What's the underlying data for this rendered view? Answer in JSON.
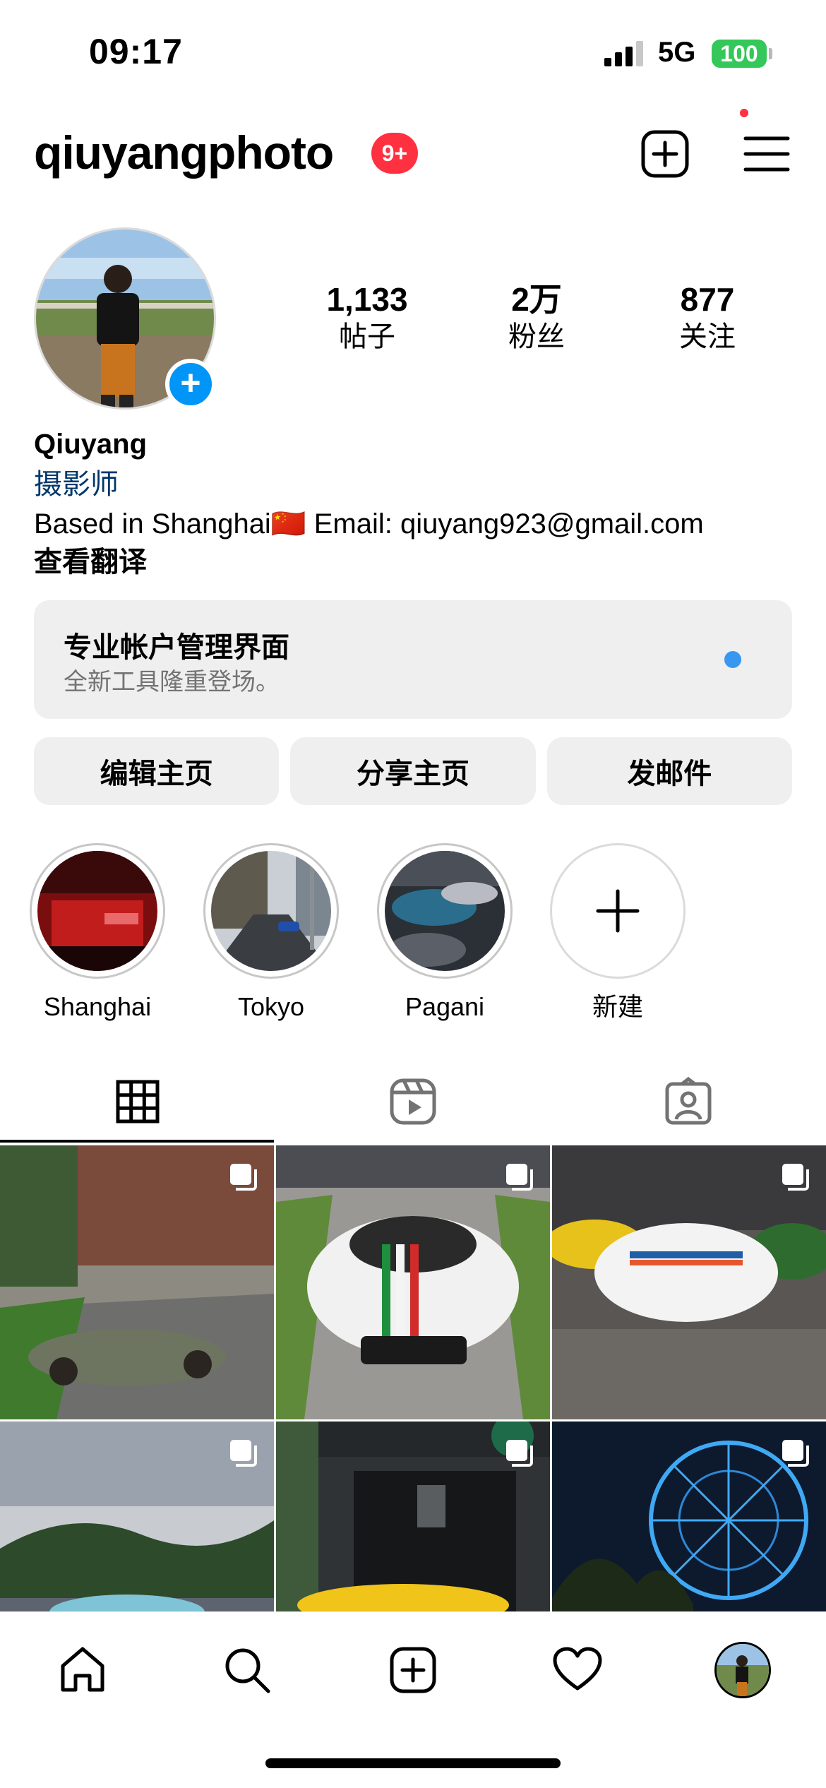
{
  "status_bar": {
    "time": "09:17",
    "network": "5G",
    "battery": "100"
  },
  "header": {
    "username": "qiuyangphoto",
    "notification_badge": "9+"
  },
  "profile": {
    "stats": [
      {
        "value": "1,133",
        "label": "帖子"
      },
      {
        "value": "2万",
        "label": "粉丝"
      },
      {
        "value": "877",
        "label": "关注"
      }
    ],
    "name": "Qiuyang",
    "category": "摄影师",
    "bio": "Based in Shanghai🇨🇳 Email: qiuyang923@gmail.com",
    "translate": "查看翻译"
  },
  "professional_dashboard": {
    "title": "专业帐户管理界面",
    "subtitle": "全新工具隆重登场。"
  },
  "actions": {
    "edit": "编辑主页",
    "share": "分享主页",
    "email": "发邮件"
  },
  "highlights": [
    {
      "label": "Shanghai"
    },
    {
      "label": "Tokyo"
    },
    {
      "label": "Pagani"
    },
    {
      "label": "新建"
    }
  ],
  "tabs": [
    "grid-icon",
    "reels-icon",
    "tagged-icon"
  ],
  "bottom_nav": [
    "home-icon",
    "search-icon",
    "create-icon",
    "heart-icon",
    "profile-avatar"
  ],
  "colors": {
    "badge_red": "#ff3040",
    "link_blue": "#00376b",
    "accent_blue": "#0095f6",
    "battery_green": "#34c759"
  }
}
